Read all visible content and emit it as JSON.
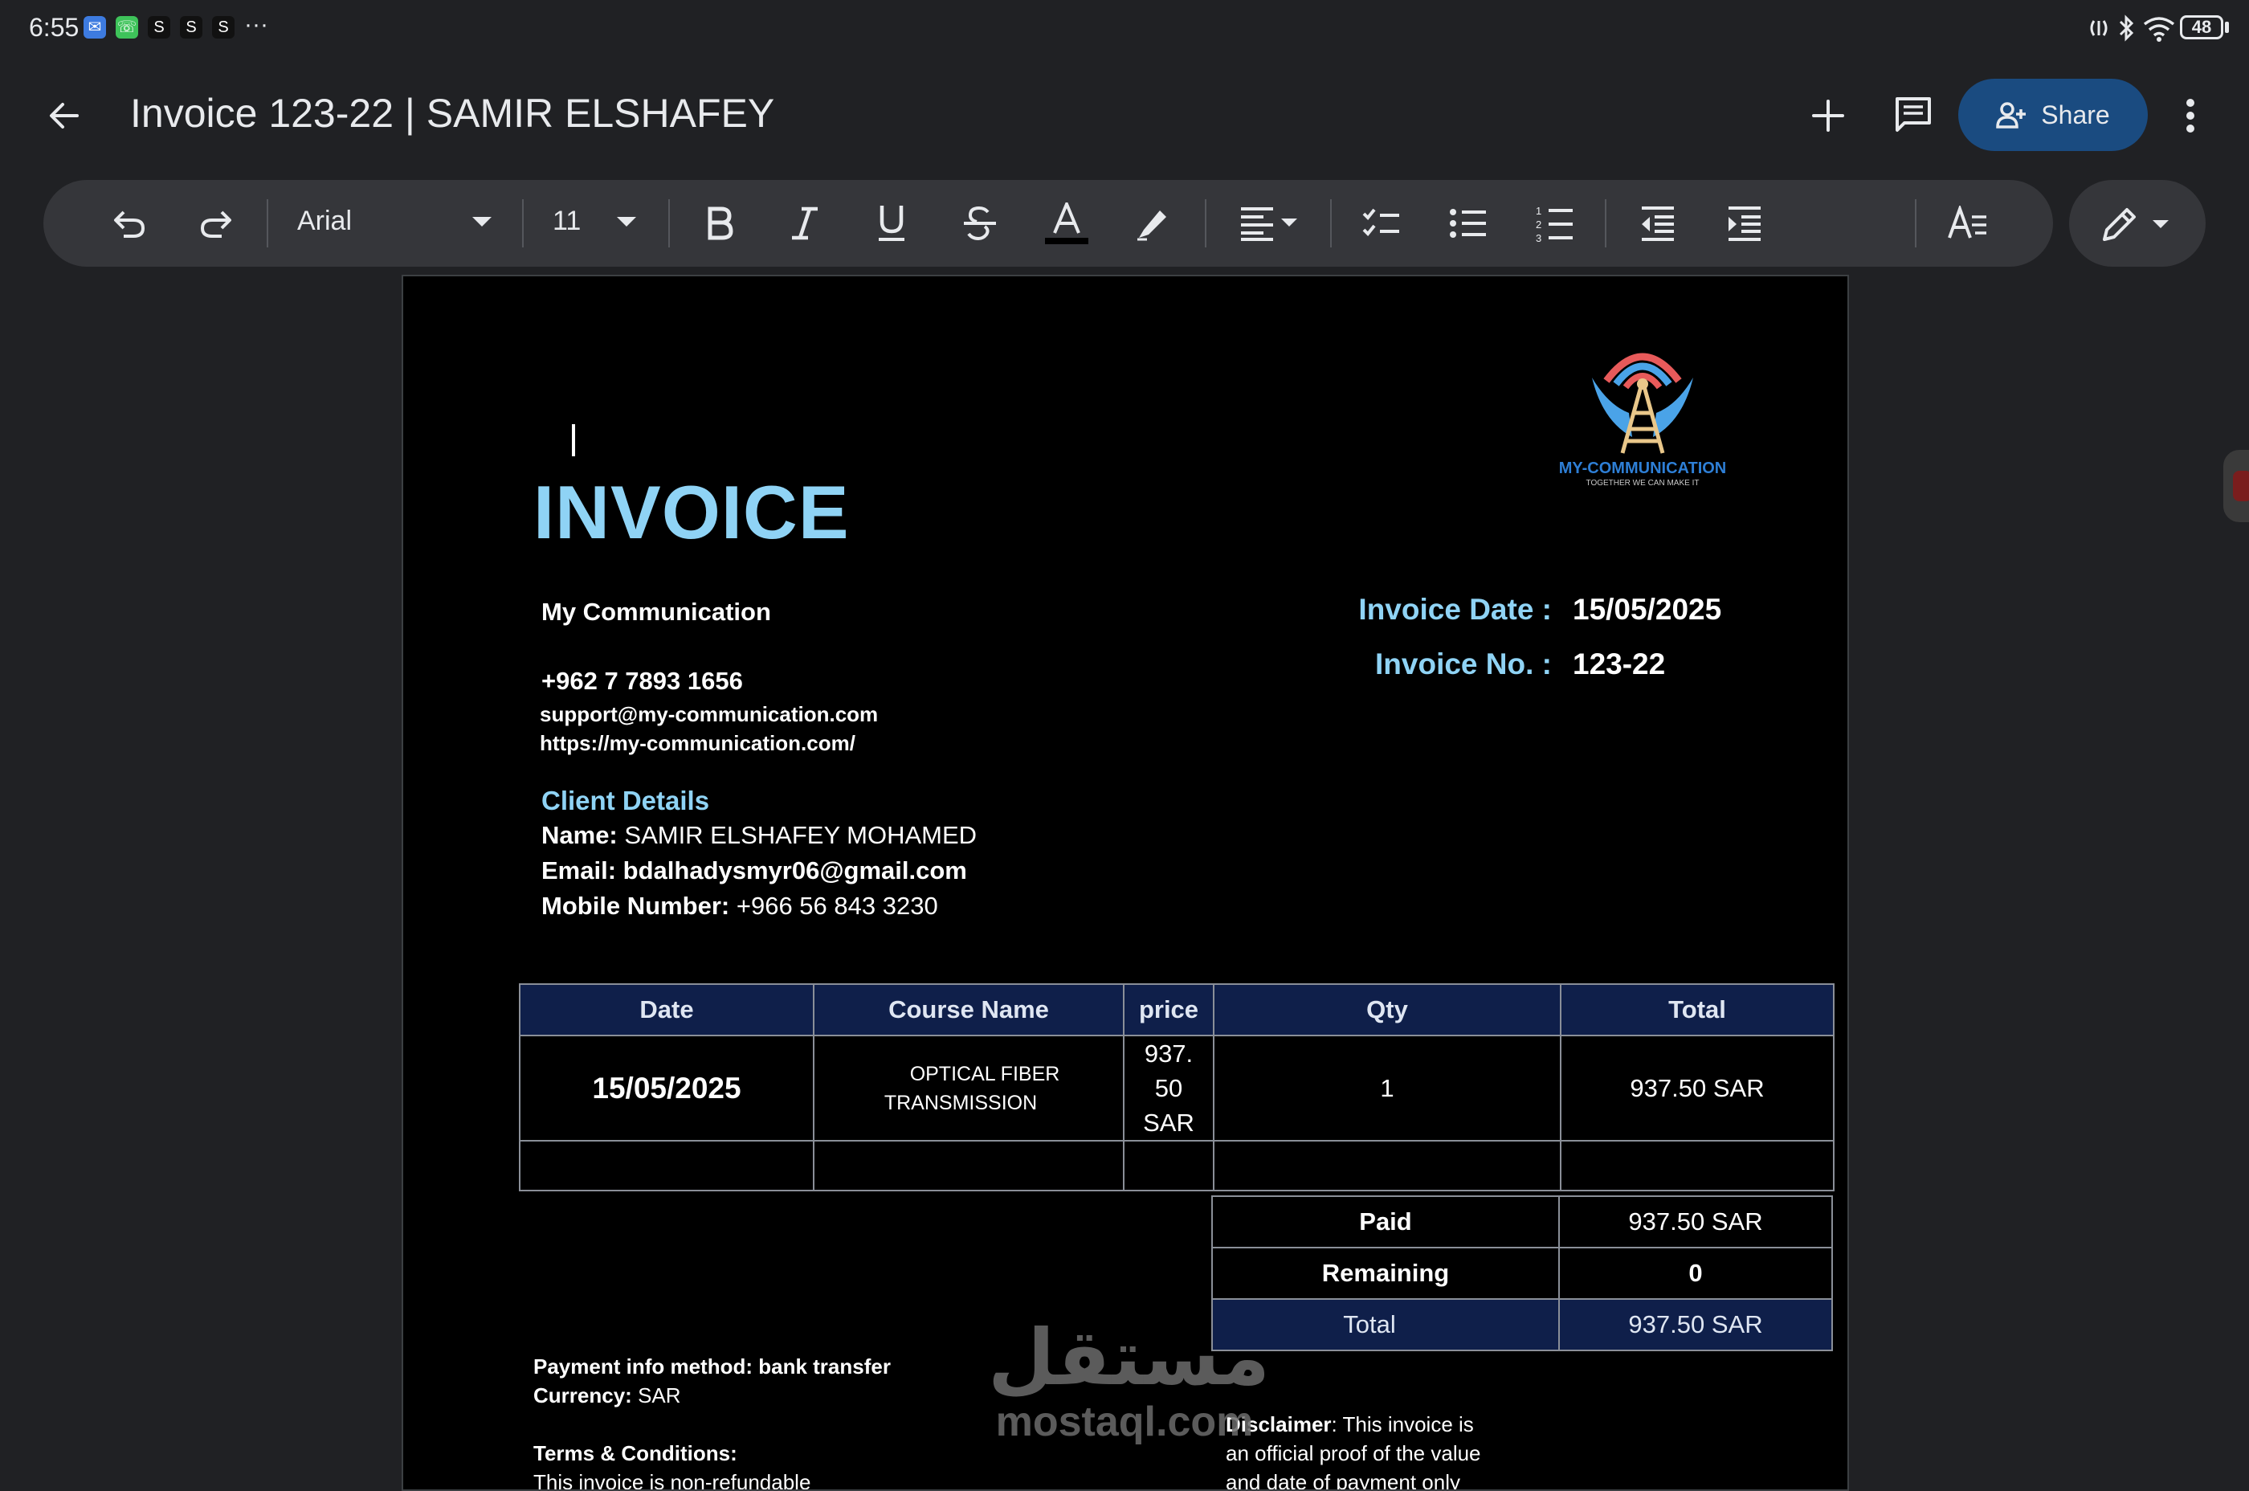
{
  "status_bar": {
    "time": "6:55",
    "dots": "···",
    "battery": "48",
    "notification_icons": [
      "messages-icon",
      "whatsapp-icon",
      "s-app-icon",
      "s-app-icon",
      "s-app-icon"
    ],
    "s_label": "S"
  },
  "appbar": {
    "title": "Invoice 123-22 | SAMIR ELSHAFEY",
    "share_label": "Share"
  },
  "toolbar": {
    "font_name": "Arial",
    "font_size": "11"
  },
  "invoice": {
    "title": "INVOICE",
    "logo_name": "MY-COMMUNICATION",
    "logo_tagline": "TOGETHER WE CAN MAKE IT",
    "company": {
      "name": "My Communication",
      "phone": "+962 7 7893 1656",
      "email": "support@my-communication.com",
      "website": "https://my-communication.com/"
    },
    "meta": {
      "date_label": "Invoice Date :",
      "date_value": "15/05/2025",
      "number_label": "Invoice No. :",
      "number_value": "123-22"
    },
    "client": {
      "heading": "Client Details",
      "name_label": "Name:",
      "name_value": "SAMIR ELSHAFEY MOHAMED",
      "email_label": "Email:",
      "email_value": "bdalhadysmyr06@gmail.com",
      "mobile_label": "Mobile Number:",
      "mobile_value": "+966 56 843 3230"
    },
    "table": {
      "headers": [
        "Date",
        "Course Name",
        "price",
        "Qty",
        "Total"
      ],
      "row": {
        "date": "15/05/2025",
        "course_line1": "OPTICAL FIBER",
        "course_line2": "TRANSMISSION",
        "price_line1": "937.",
        "price_line2": "50",
        "price_line3": "SAR",
        "qty": "1",
        "total": "937.50 SAR"
      }
    },
    "summary": {
      "paid_label": "Paid",
      "paid_value": "937.50 SAR",
      "remaining_label": "Remaining",
      "remaining_value": "0",
      "total_label": "Total",
      "total_value": "937.50 SAR"
    },
    "footer": {
      "payment": "Payment info method: bank transfer",
      "currency_label": "Currency:",
      "currency_value": "SAR",
      "terms_heading": "Terms & Conditions:",
      "terms_partial": "This invoice is non-refundable",
      "disclaimer_label": "Disclaimer",
      "disclaimer_line1": ": This invoice is",
      "disclaimer_line2": "an official proof of the value",
      "disclaimer_line3": "and date of payment only"
    },
    "watermark": {
      "arabic": "مستقل",
      "latin": "mostaql.com"
    }
  }
}
